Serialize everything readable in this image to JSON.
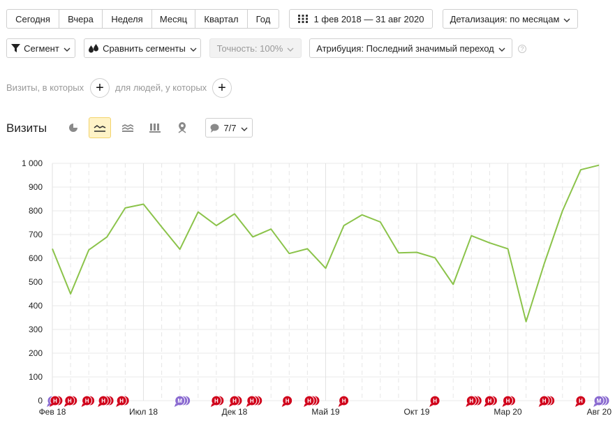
{
  "periods": [
    "Сегодня",
    "Вчера",
    "Неделя",
    "Месяц",
    "Квартал",
    "Год"
  ],
  "date_range": "1 фев 2018 — 31 авг 2020",
  "detail": "Детализация: по месяцам",
  "segment": "Сегмент",
  "compare": "Сравнить сегменты",
  "accuracy": "Точность: 100%",
  "attribution": "Атрибуция: Последний значимый переход",
  "help": "?",
  "visits_where": "Визиты, в которых",
  "people_where": "для людей, у которых",
  "plus": "+",
  "chart_title": "Визиты",
  "series_count": "7/7",
  "annotation_letters": {
    "red": "Н",
    "purple": "М"
  },
  "colors": {
    "line": "#8bc34a",
    "grid": "#e9e9e9",
    "active_bg": "#fff3c7",
    "annot_red": "#d0021b",
    "annot_purple": "#8a6ad0"
  },
  "chart_data": {
    "type": "line",
    "title": "Визиты",
    "xlabel": "",
    "ylabel": "",
    "ylim": [
      0,
      1000
    ],
    "yticks": [
      "0",
      "100",
      "200",
      "300",
      "400",
      "500",
      "600",
      "700",
      "800",
      "900",
      "1 000"
    ],
    "xtick_labels": [
      {
        "index": 0,
        "label": "Фев 18"
      },
      {
        "index": 5,
        "label": "Июл 18"
      },
      {
        "index": 10,
        "label": "Дек 18"
      },
      {
        "index": 15,
        "label": "Май 19"
      },
      {
        "index": 20,
        "label": "Окт 19"
      },
      {
        "index": 25,
        "label": "Мар 20"
      },
      {
        "index": 30,
        "label": "Авг 20"
      }
    ],
    "x": [
      "2018-02",
      "2018-03",
      "2018-04",
      "2018-05",
      "2018-06",
      "2018-07",
      "2018-08",
      "2018-09",
      "2018-10",
      "2018-11",
      "2018-12",
      "2019-01",
      "2019-02",
      "2019-03",
      "2019-04",
      "2019-05",
      "2019-06",
      "2019-07",
      "2019-08",
      "2019-09",
      "2019-10",
      "2019-11",
      "2019-12",
      "2020-01",
      "2020-02",
      "2020-03",
      "2020-04",
      "2020-05",
      "2020-06",
      "2020-07",
      "2020-08"
    ],
    "values": [
      640,
      450,
      635,
      690,
      812,
      828,
      732,
      638,
      795,
      738,
      787,
      690,
      723,
      620,
      640,
      558,
      738,
      783,
      753,
      623,
      625,
      602,
      490,
      695,
      665,
      640,
      333,
      578,
      800,
      973,
      992
    ],
    "grid": true,
    "legend": "none",
    "annotations": [
      {
        "x": 0.0,
        "type": "purple",
        "count": 1
      },
      {
        "x": 0.15,
        "type": "red",
        "count": 2
      },
      {
        "x": 0.95,
        "type": "red",
        "count": 2
      },
      {
        "x": 1.9,
        "type": "red",
        "count": 2
      },
      {
        "x": 2.8,
        "type": "red",
        "count": 3
      },
      {
        "x": 3.8,
        "type": "red",
        "count": 2
      },
      {
        "x": 7.0,
        "type": "purple",
        "count": 3
      },
      {
        "x": 9.0,
        "type": "red",
        "count": 2
      },
      {
        "x": 10.0,
        "type": "red",
        "count": 2
      },
      {
        "x": 10.95,
        "type": "red",
        "count": 3
      },
      {
        "x": 12.9,
        "type": "red",
        "count": 1
      },
      {
        "x": 14.1,
        "type": "red",
        "count": 3
      },
      {
        "x": 16.0,
        "type": "red",
        "count": 1
      },
      {
        "x": 21.0,
        "type": "red",
        "count": 1
      },
      {
        "x": 23.0,
        "type": "red",
        "count": 3
      },
      {
        "x": 24.0,
        "type": "red",
        "count": 2
      },
      {
        "x": 25.0,
        "type": "red",
        "count": 2
      },
      {
        "x": 27.0,
        "type": "red",
        "count": 3
      },
      {
        "x": 29.0,
        "type": "red",
        "count": 1
      },
      {
        "x": 30.0,
        "type": "purple",
        "count": 3
      }
    ]
  }
}
